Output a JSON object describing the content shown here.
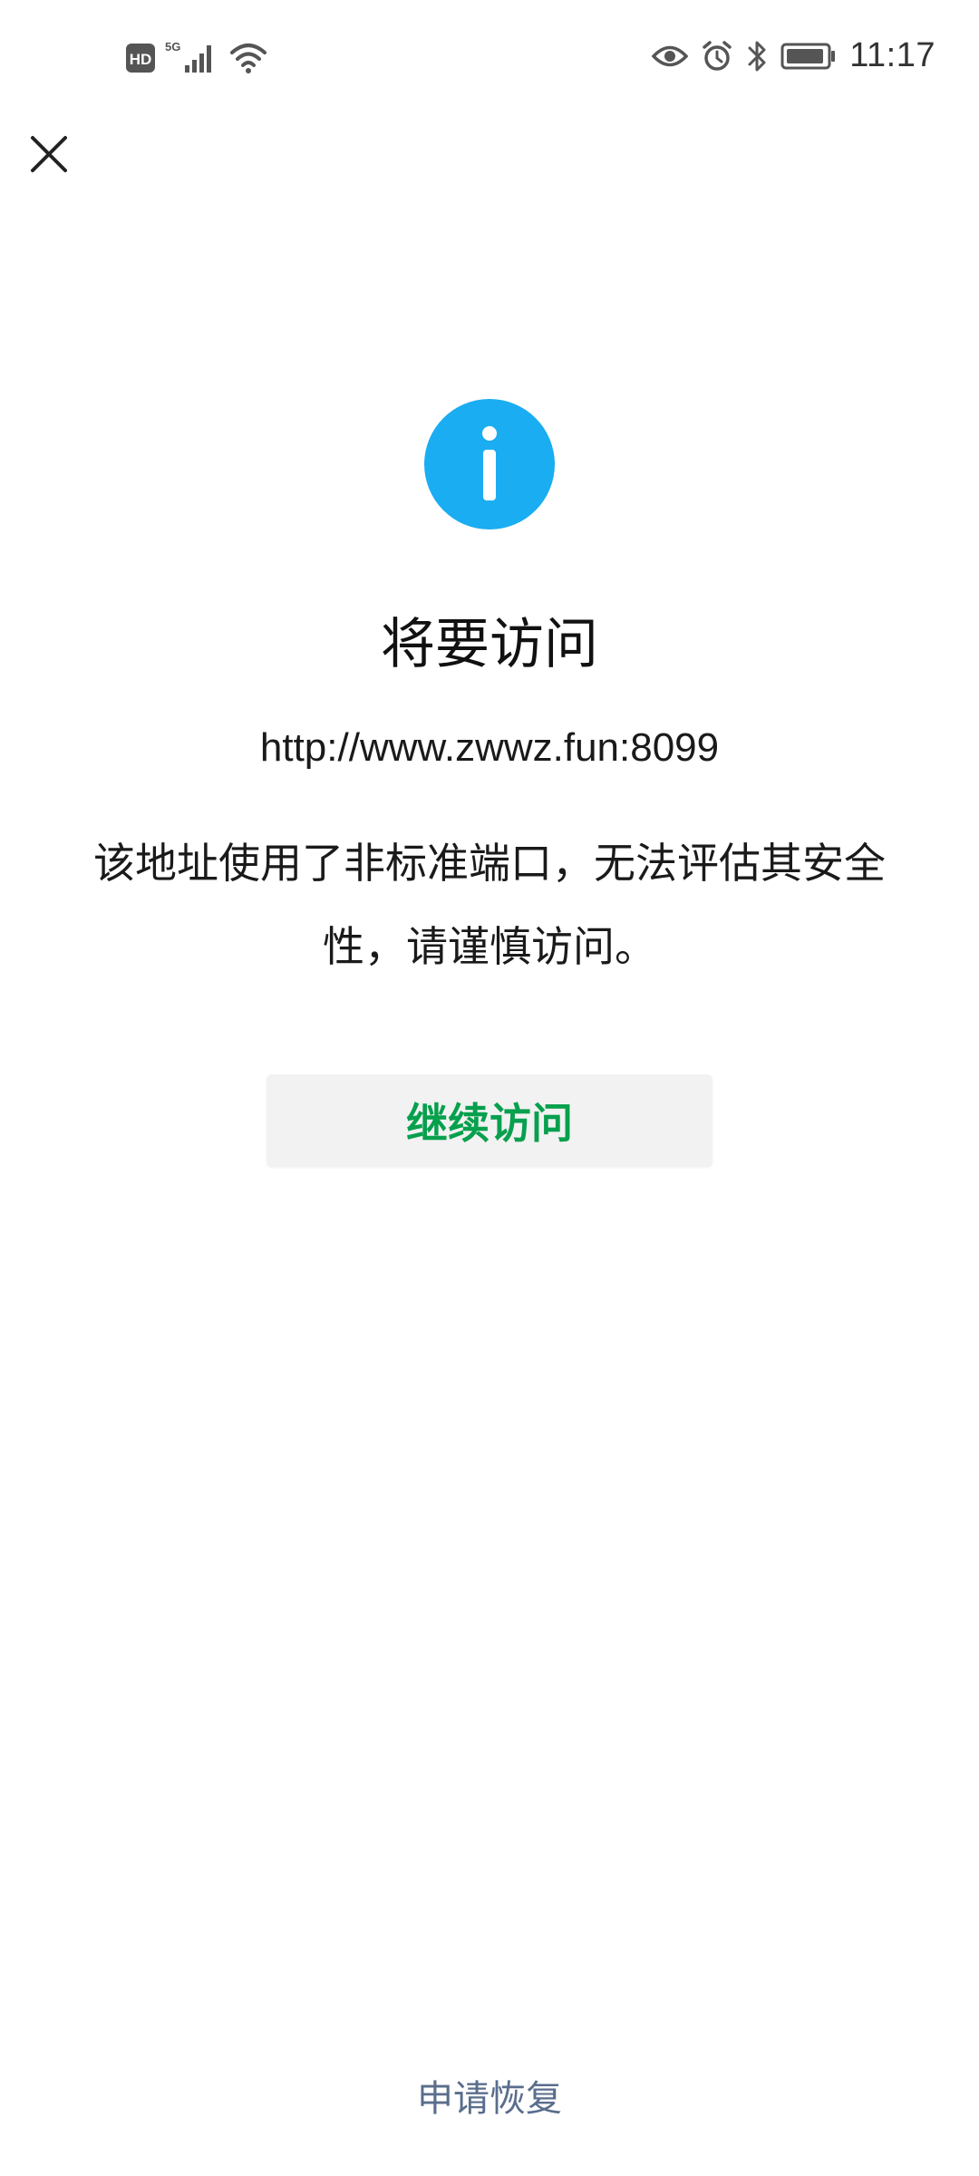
{
  "status_bar": {
    "left_icons": [
      "hd-icon",
      "5g-signal-icon",
      "wifi-icon"
    ],
    "right_icons": [
      "eye-icon",
      "alarm-icon",
      "bluetooth-icon",
      "battery-icon"
    ],
    "hd_label": "HD",
    "network_label": "5G",
    "time": "11:17"
  },
  "header": {
    "close_icon": "close-icon"
  },
  "main": {
    "icon": "info-icon",
    "icon_color": "#1aadf2",
    "title": "将要访问",
    "url": "http://www.zwwz.fun:8099",
    "warning": "该地址使用了非标准端口，无法评估其安全性，请谨慎访问。",
    "continue_label": "继续访问",
    "continue_color": "#07a04d"
  },
  "footer": {
    "appeal_label": "申请恢复"
  }
}
